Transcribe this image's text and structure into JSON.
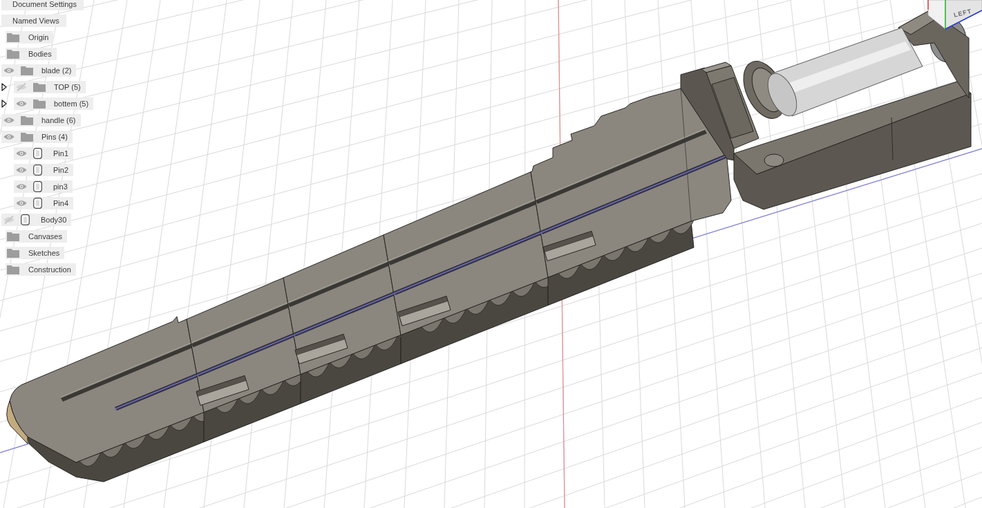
{
  "browser": {
    "items": [
      {
        "label": "Document Settings",
        "kind": "setting"
      },
      {
        "label": "Named Views",
        "kind": "setting"
      },
      {
        "label": "Origin",
        "kind": "folder"
      },
      {
        "label": "Bodies",
        "kind": "folder",
        "children": [
          {
            "label": "blade (2)",
            "kind": "folder",
            "visible": true,
            "children": [
              {
                "label": "TOP (5)",
                "kind": "folder",
                "visible": false,
                "expanded": false
              },
              {
                "label": "bottem (5)",
                "kind": "folder",
                "visible": true,
                "expanded": false
              }
            ]
          },
          {
            "label": "handle (6)",
            "kind": "folder",
            "visible": true
          },
          {
            "label": "Pins (4)",
            "kind": "folder",
            "visible": true,
            "children": [
              {
                "label": "Pin1",
                "kind": "body",
                "visible": true
              },
              {
                "label": "Pin2",
                "kind": "body",
                "visible": true
              },
              {
                "label": "pin3",
                "kind": "body",
                "visible": true
              },
              {
                "label": "Pin4",
                "kind": "body",
                "visible": true
              }
            ]
          },
          {
            "label": "Body30",
            "kind": "body",
            "visible": false
          }
        ]
      },
      {
        "label": "Canvases",
        "kind": "folder"
      },
      {
        "label": "Sketches",
        "kind": "folder"
      },
      {
        "label": "Construction",
        "kind": "folder"
      }
    ]
  },
  "view_cube": {
    "face_label": "LEFT"
  }
}
